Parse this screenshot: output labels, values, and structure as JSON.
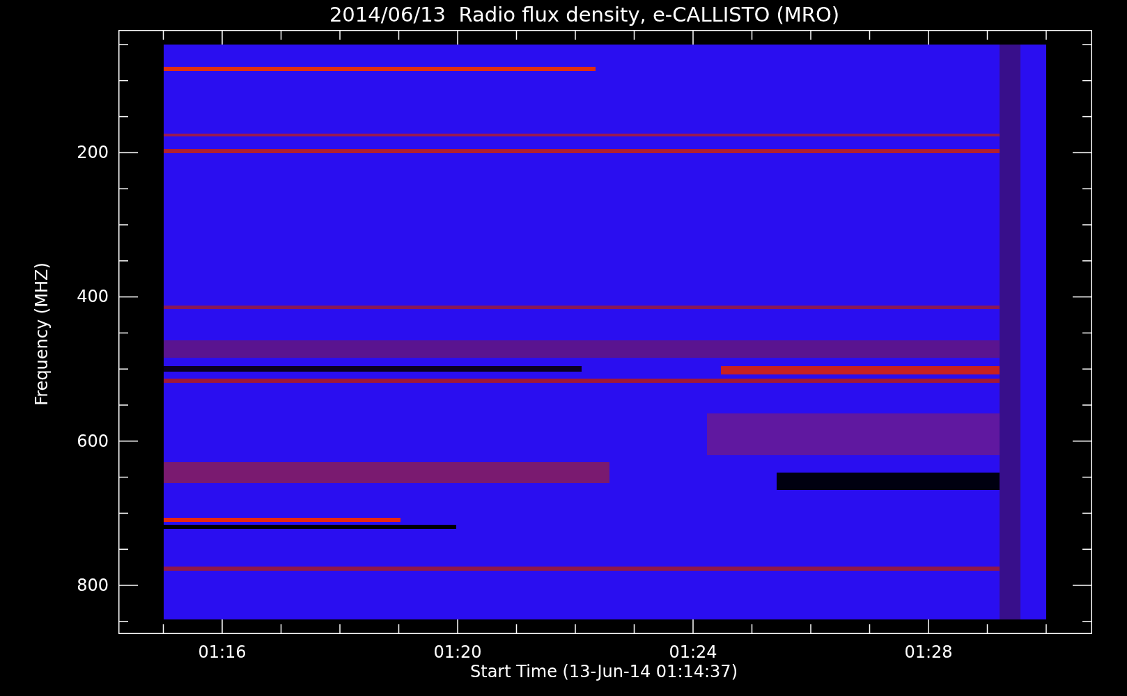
{
  "title": "2014/06/13  Radio flux density, e-CALLISTO (MRO)",
  "y_axis": {
    "label": "Frequency (MHZ)",
    "ticks": [
      "200",
      "400",
      "600",
      "800"
    ]
  },
  "x_axis": {
    "label": "Start Time (13-Jun-14 01:14:37)",
    "ticks": [
      "01:16",
      "01:20",
      "01:24",
      "01:28"
    ]
  }
}
